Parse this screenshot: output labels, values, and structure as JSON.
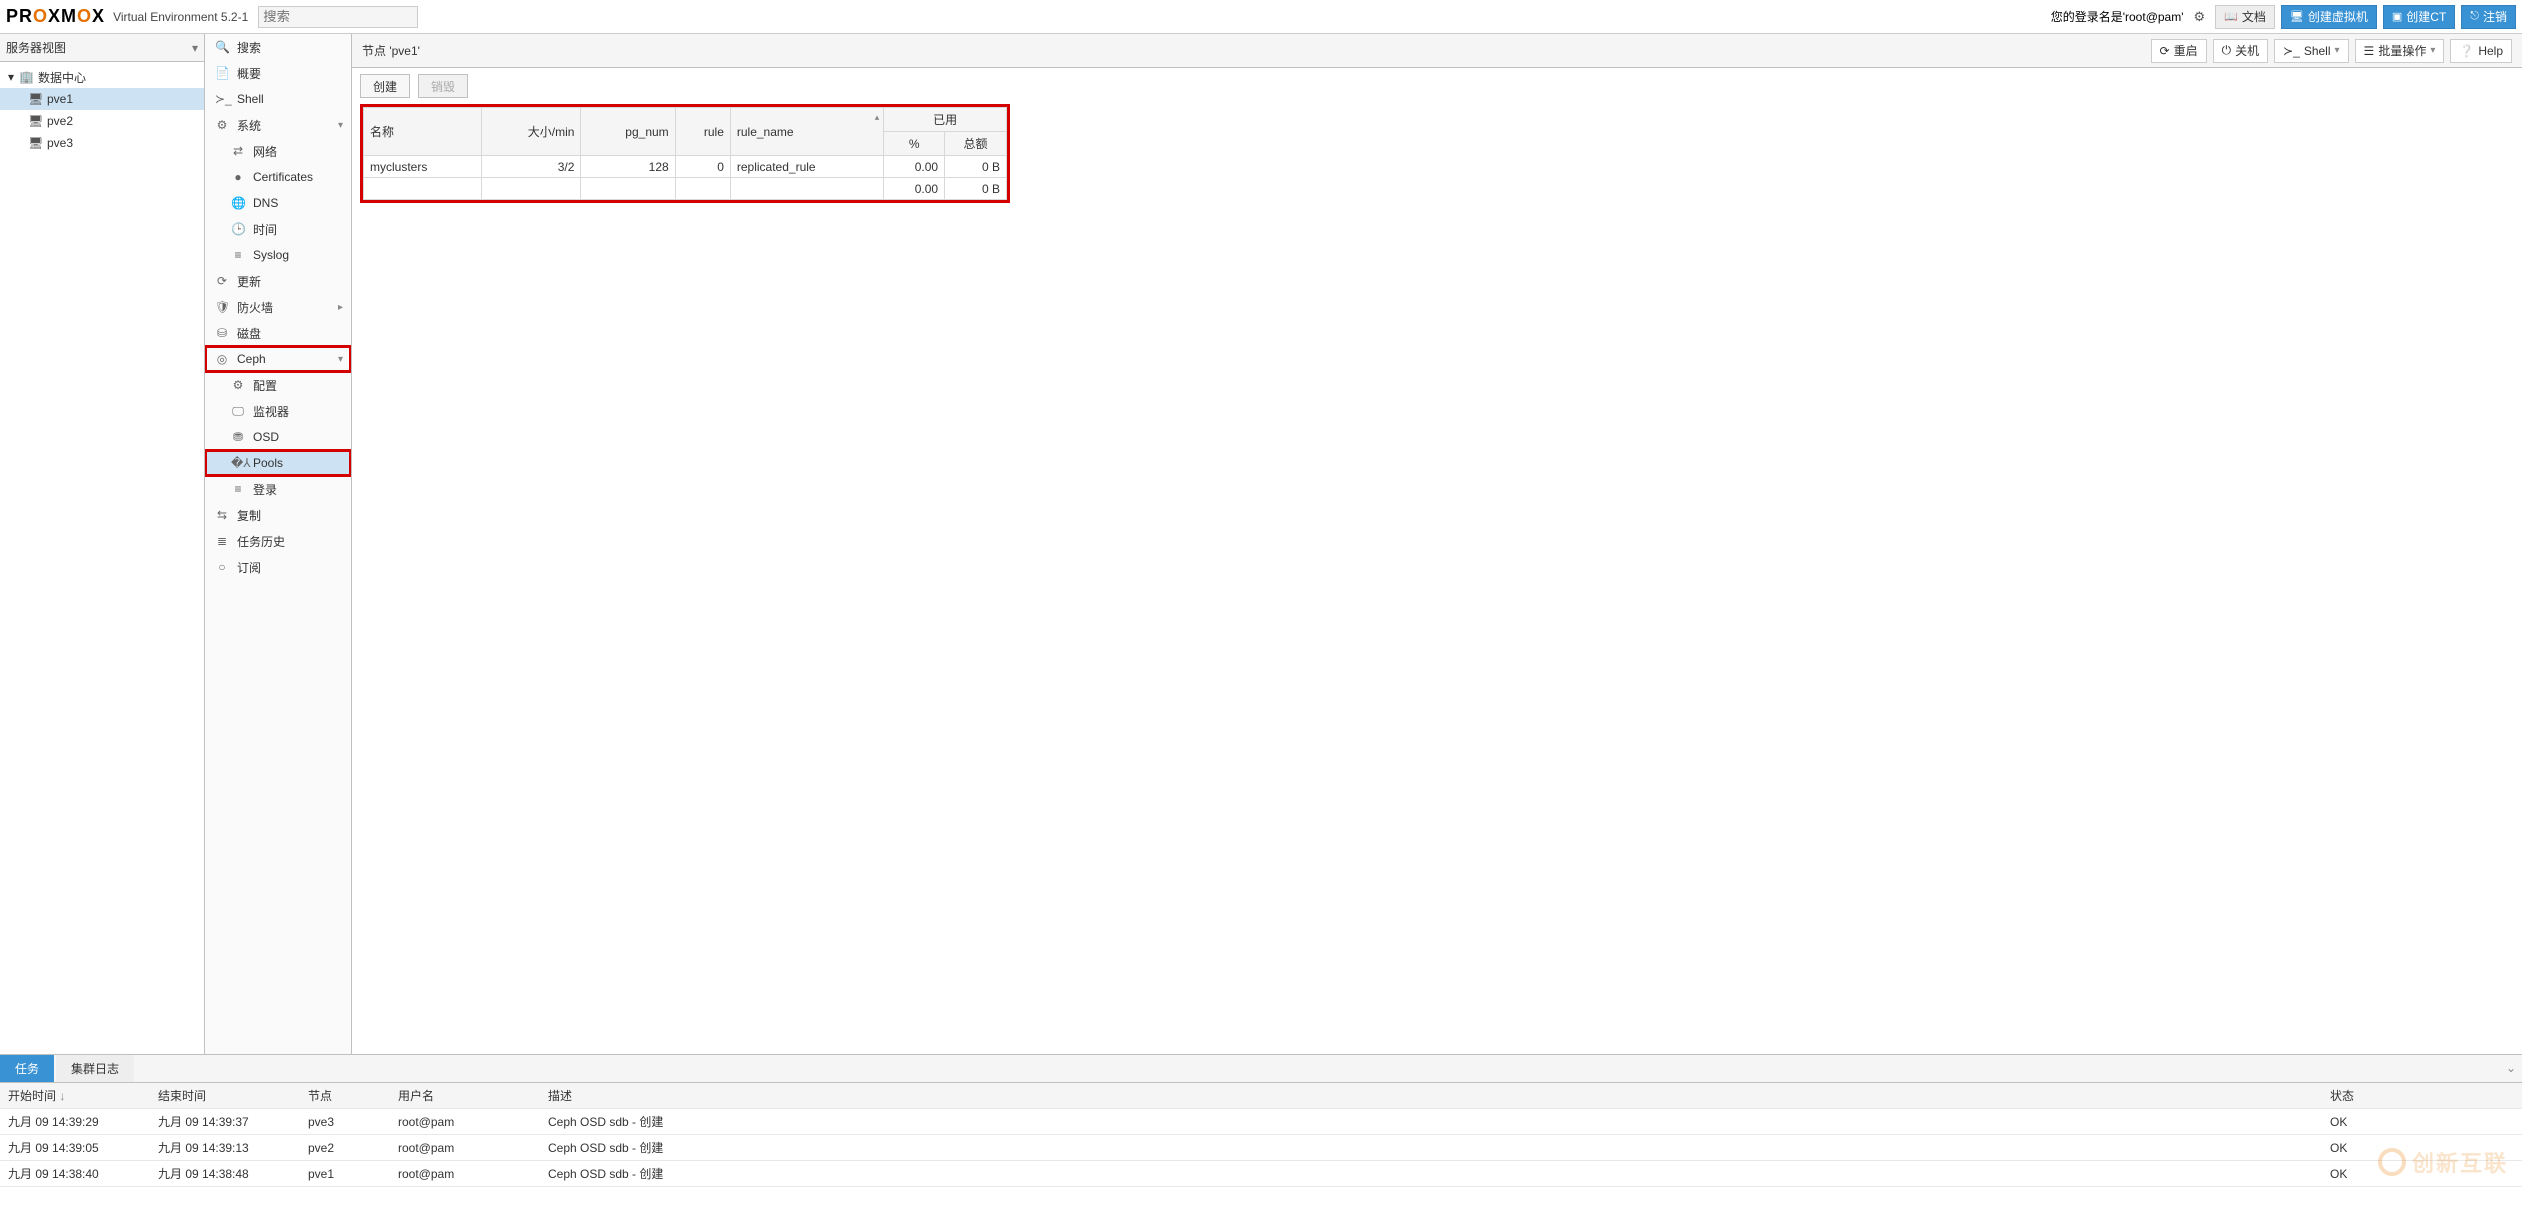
{
  "header": {
    "logo_text_1": "PR",
    "logo_o1": "O",
    "logo_text_2": "XM",
    "logo_o2": "O",
    "logo_text_3": "X",
    "version": "Virtual Environment 5.2-1",
    "search_placeholder": "搜索",
    "login_text": "您的登录名是'root@pam'",
    "doc_label": "文档",
    "create_vm_label": "创建虚拟机",
    "create_ct_label": "创建CT",
    "logout_label": "注销"
  },
  "left": {
    "view_label": "服务器视图",
    "tree": {
      "datacenter": "数据中心",
      "nodes": [
        "pve1",
        "pve2",
        "pve3"
      ]
    }
  },
  "mid": {
    "items": {
      "search": "搜索",
      "summary": "概要",
      "shell": "Shell",
      "system": "系统",
      "network": "网络",
      "certificates": "Certificates",
      "dns": "DNS",
      "time": "时间",
      "syslog": "Syslog",
      "update": "更新",
      "firewall": "防火墙",
      "disk": "磁盘",
      "ceph": "Ceph",
      "config": "配置",
      "monitor": "监视器",
      "osd": "OSD",
      "pools": "Pools",
      "log": "登录",
      "replication": "复制",
      "taskhistory": "任务历史",
      "subscription": "订阅"
    }
  },
  "nodebar": {
    "title": "节点 'pve1'",
    "restart": "重启",
    "shutdown": "关机",
    "shell": "Shell",
    "bulk": "批量操作",
    "help": "Help"
  },
  "toolbar": {
    "create": "创建",
    "destroy": "销毁"
  },
  "grid": {
    "headers": {
      "name": "名称",
      "size": "大小/min",
      "pgnum": "pg_num",
      "rule": "rule",
      "rulename": "rule_name",
      "used": "已用",
      "pct": "%",
      "total": "总额"
    },
    "rows": [
      {
        "name": "myclusters",
        "size": "3/2",
        "pgnum": "128",
        "rule": "0",
        "rulename": "replicated_rule",
        "pct": "0.00",
        "total": "0 B"
      },
      {
        "name": "",
        "size": "",
        "pgnum": "",
        "rule": "",
        "rulename": "",
        "pct": "0.00",
        "total": "0 B"
      }
    ]
  },
  "logs": {
    "tabs": {
      "tasks": "任务",
      "cluster": "集群日志"
    },
    "headers": {
      "start": "开始时间",
      "end": "结束时间",
      "node": "节点",
      "user": "用户名",
      "desc": "描述",
      "status": "状态"
    },
    "rows": [
      {
        "start": "九月 09 14:39:29",
        "end": "九月 09 14:39:37",
        "node": "pve3",
        "user": "root@pam",
        "desc": "Ceph OSD sdb - 创建",
        "status": "OK"
      },
      {
        "start": "九月 09 14:39:05",
        "end": "九月 09 14:39:13",
        "node": "pve2",
        "user": "root@pam",
        "desc": "Ceph OSD sdb - 创建",
        "status": "OK"
      },
      {
        "start": "九月 09 14:38:40",
        "end": "九月 09 14:38:48",
        "node": "pve1",
        "user": "root@pam",
        "desc": "Ceph OSD sdb - 创建",
        "status": "OK"
      }
    ]
  },
  "watermark": "创新互联"
}
